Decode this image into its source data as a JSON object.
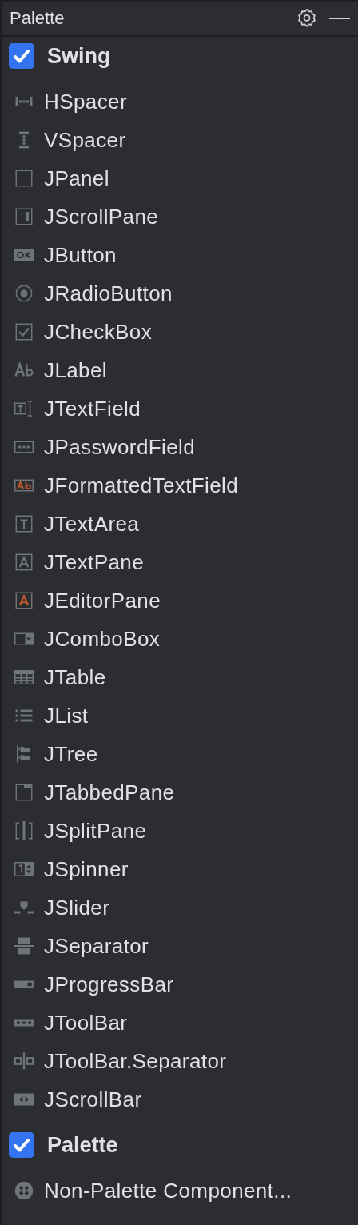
{
  "panel": {
    "title": "Palette"
  },
  "groups": [
    {
      "label": "Swing",
      "checked": true,
      "items": [
        {
          "label": "HSpacer",
          "kind": "hspacer"
        },
        {
          "label": "VSpacer",
          "kind": "vspacer"
        },
        {
          "label": "JPanel",
          "kind": "panel"
        },
        {
          "label": "JScrollPane",
          "kind": "scrollpane"
        },
        {
          "label": "JButton",
          "kind": "button"
        },
        {
          "label": "JRadioButton",
          "kind": "radio"
        },
        {
          "label": "JCheckBox",
          "kind": "checkbox"
        },
        {
          "label": "JLabel",
          "kind": "label"
        },
        {
          "label": "JTextField",
          "kind": "textfield"
        },
        {
          "label": "JPasswordField",
          "kind": "password"
        },
        {
          "label": "JFormattedTextField",
          "kind": "formatted"
        },
        {
          "label": "JTextArea",
          "kind": "textarea"
        },
        {
          "label": "JTextPane",
          "kind": "textpane"
        },
        {
          "label": "JEditorPane",
          "kind": "editorpane"
        },
        {
          "label": "JComboBox",
          "kind": "combobox"
        },
        {
          "label": "JTable",
          "kind": "table"
        },
        {
          "label": "JList",
          "kind": "list"
        },
        {
          "label": "JTree",
          "kind": "tree"
        },
        {
          "label": "JTabbedPane",
          "kind": "tabbed"
        },
        {
          "label": "JSplitPane",
          "kind": "split"
        },
        {
          "label": "JSpinner",
          "kind": "spinner"
        },
        {
          "label": "JSlider",
          "kind": "slider"
        },
        {
          "label": "JSeparator",
          "kind": "separator"
        },
        {
          "label": "JProgressBar",
          "kind": "progress"
        },
        {
          "label": "JToolBar",
          "kind": "toolbar"
        },
        {
          "label": "JToolBar.Separator",
          "kind": "toolbarsep"
        },
        {
          "label": "JScrollBar",
          "kind": "scrollbar"
        }
      ]
    },
    {
      "label": "Palette",
      "checked": true,
      "items": [
        {
          "label": "Non-Palette Component...",
          "kind": "nonpalette"
        }
      ]
    }
  ]
}
